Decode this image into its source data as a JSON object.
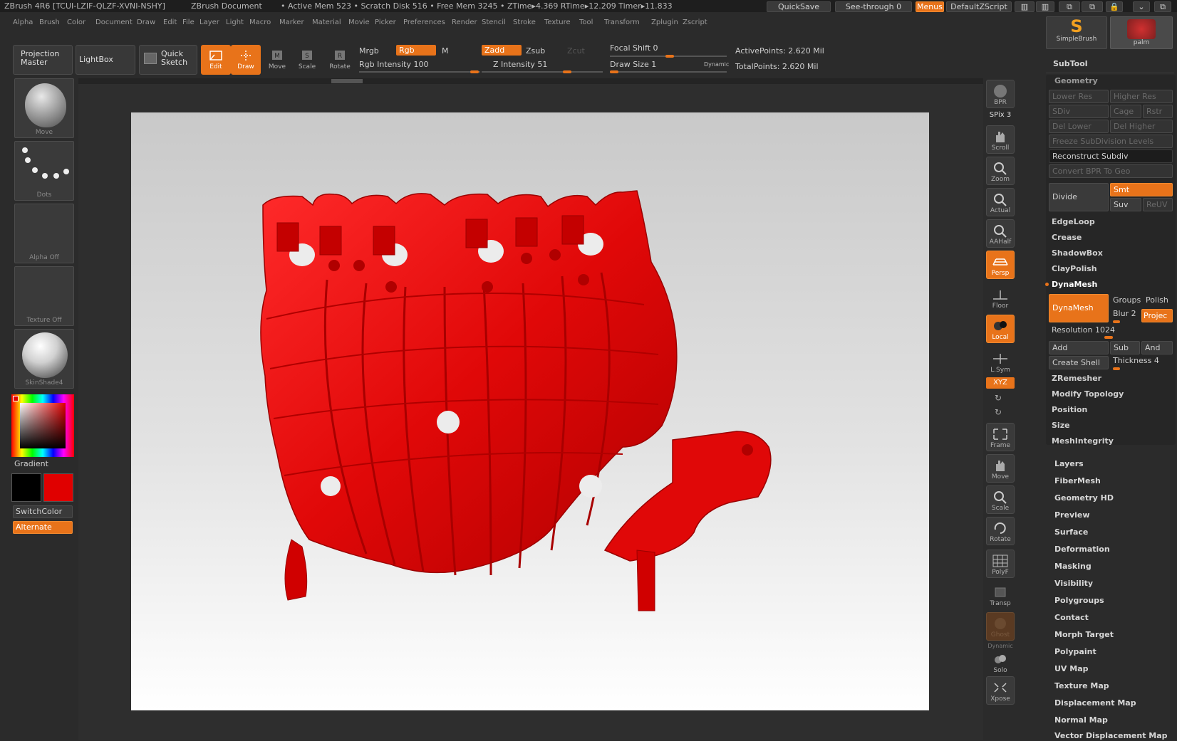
{
  "titlebar": {
    "app": "ZBrush 4R6 [TCUI-LZIF-QLZF-XVNI-NSHY]",
    "document": "ZBrush Document",
    "stats": "• Active Mem 523 • Scratch Disk 516 • Free Mem 3245 • ZTime▸4.369 RTime▸12.209 Timer▸11.833",
    "quicksave": "QuickSave",
    "seethrough": "See-through  0",
    "menus": "Menus",
    "default_zscript": "DefaultZScript"
  },
  "menubar": [
    "Alpha",
    "Brush",
    "Color",
    "Document",
    "Draw",
    "Edit",
    "File",
    "Layer",
    "Light",
    "Macro",
    "Marker",
    "Material",
    "Movie",
    "Picker",
    "Preferences",
    "Render",
    "Stencil",
    "Stroke",
    "Texture",
    "Tool",
    "Transform",
    "Zplugin",
    "Zscript"
  ],
  "shelf": {
    "projection_master": "Projection Master",
    "lightbox": "LightBox",
    "quick_sketch": "Quick Sketch",
    "tools": [
      {
        "label": "Edit",
        "icon": "edit-icon",
        "active": true
      },
      {
        "label": "Draw",
        "icon": "draw-icon",
        "active": true
      },
      {
        "label": "Move",
        "icon": "move-icon",
        "active": false
      },
      {
        "label": "Scale",
        "icon": "scale-icon",
        "active": false
      },
      {
        "label": "Rotate",
        "icon": "rotate-icon",
        "active": false
      }
    ],
    "mrgb": "Mrgb",
    "rgb": "Rgb",
    "m": "M",
    "rgb_intensity": "Rgb Intensity 100",
    "zadd": "Zadd",
    "zsub": "Zsub",
    "zcut": "Zcut",
    "z_intensity": "Z Intensity 51",
    "focal_shift": "Focal Shift 0",
    "draw_size": "Draw Size 1",
    "dynamic": "Dynamic",
    "active_points": "ActivePoints: 2.620  Mil",
    "total_points": "TotalPoints: 2.620  Mil"
  },
  "leftpanel": {
    "brush": "Move",
    "stroke": "Dots",
    "alpha": "Alpha  Off",
    "texture": "Texture  Off",
    "material": "SkinShade4",
    "gradient": "Gradient",
    "switchcolor": "SwitchColor",
    "alternate": "Alternate",
    "primary_color": "#000000",
    "secondary_color": "#e00000"
  },
  "rightstrip": [
    {
      "label": "BPR",
      "icon": "bpr-icon"
    },
    {
      "label": "SPix 3",
      "icon": ""
    },
    {
      "label": "Scroll",
      "icon": "scroll-icon"
    },
    {
      "label": "Zoom",
      "icon": "zoom-icon"
    },
    {
      "label": "Actual",
      "icon": "actual-icon"
    },
    {
      "label": "AAHalf",
      "icon": "aahalf-icon"
    },
    {
      "label": "Persp",
      "icon": "persp-icon"
    },
    {
      "label": "Floor",
      "icon": "floor-icon"
    },
    {
      "label": "Local",
      "icon": "local-icon"
    },
    {
      "label": "L.Sym",
      "icon": "lsym-icon"
    },
    {
      "label": "XYZ",
      "icon": "xyz-icon"
    },
    {
      "label": "Frame",
      "icon": "frame-icon"
    },
    {
      "label": "Move",
      "icon": "move-icon"
    },
    {
      "label": "Scale",
      "icon": "scale-icon"
    },
    {
      "label": "Rotate",
      "icon": "rotate-icon"
    },
    {
      "label": "PolyF",
      "icon": "polyf-icon"
    },
    {
      "label": "Transp",
      "icon": "transp-icon"
    },
    {
      "label": "Ghost",
      "icon": "ghost-icon"
    },
    {
      "label": "Dynamic",
      "icon": ""
    },
    {
      "label": "Solo",
      "icon": "solo-icon"
    },
    {
      "label": "Xpose",
      "icon": "xpose-icon"
    }
  ],
  "rightpanel": {
    "simplebrush": "SimpleBrush",
    "palm": "palm",
    "subtool": "SubTool",
    "geometry": "Geometry",
    "lower_res": "Lower Res",
    "higher_res": "Higher Res",
    "sdiv": "SDiv",
    "cage": "Cage",
    "rstr": "Rstr",
    "del_lower": "Del Lower",
    "del_higher": "Del Higher",
    "freeze": "Freeze SubDivision Levels",
    "reconstruct": "Reconstruct Subdiv",
    "convert_bpr": "Convert BPR To Geo",
    "divide": "Divide",
    "smt": "Smt",
    "suv": "Suv",
    "reuv": "ReUV",
    "edgeloop": "EdgeLoop",
    "crease": "Crease",
    "shadowbox": "ShadowBox",
    "claypolish": "ClayPolish",
    "dynamesh_head": "DynaMesh",
    "dynamesh_btn": "DynaMesh",
    "groups": "Groups",
    "polish": "Polish",
    "blur": "Blur 2",
    "project": "Projec",
    "resolution": "Resolution 1024",
    "add": "Add",
    "sub": "Sub",
    "and": "And",
    "create_shell": "Create Shell",
    "thickness": "Thickness 4",
    "zremesher": "ZRemesher",
    "modify_topology": "Modify Topology",
    "position": "Position",
    "size": "Size",
    "meshintegrity": "MeshIntegrity",
    "sections": [
      "Layers",
      "FiberMesh",
      "Geometry HD",
      "Preview",
      "Surface",
      "Deformation",
      "Masking",
      "Visibility",
      "Polygroups",
      "Contact",
      "Morph Target",
      "Polypaint",
      "UV Map",
      "Texture Map",
      "Displacement Map",
      "Normal Map",
      "Vector Displacement Map"
    ]
  },
  "colors": {
    "accent": "#e8731a",
    "model": "#e00808"
  }
}
